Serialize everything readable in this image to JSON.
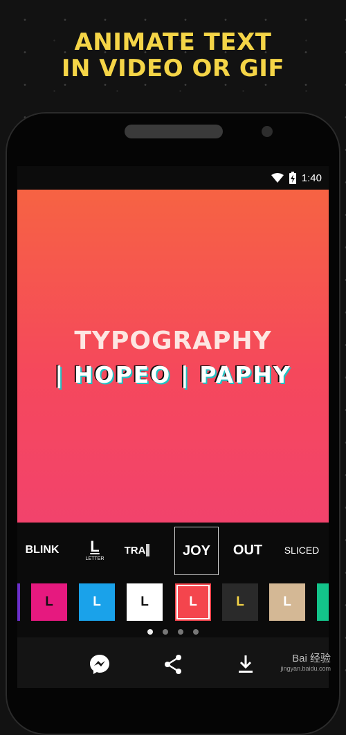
{
  "headline": {
    "line1": "ANIMATE TEXT",
    "line2": "IN VIDEO OR GIF"
  },
  "status_bar": {
    "time": "1:40",
    "icons": [
      "wifi-icon",
      "battery-charging-icon"
    ]
  },
  "preview": {
    "title_text": "TYPOGRAPHY",
    "animated_text": "| HOPEO | PAPHY"
  },
  "effects": [
    {
      "label": "BLINK",
      "selected": false
    },
    {
      "label": "L",
      "sublabel": "LETTER",
      "selected": false
    },
    {
      "label": "TRA",
      "selected": false
    },
    {
      "label": "JOY",
      "selected": true
    },
    {
      "label": "OUT",
      "selected": false
    },
    {
      "label": "SLICED",
      "selected": false
    }
  ],
  "swatches": [
    {
      "label": "",
      "bg": "#6b2fc9",
      "fg": "#ffffff"
    },
    {
      "label": "L",
      "bg": "#e6197f",
      "fg": "#111111"
    },
    {
      "label": "L",
      "bg": "#1aa2ea",
      "fg": "#ffffff"
    },
    {
      "label": "L",
      "bg": "#ffffff",
      "fg": "#111111"
    },
    {
      "label": "L",
      "bg": "#f4454d",
      "fg": "#ffffff",
      "selected": true
    },
    {
      "label": "L",
      "bg": "#2a2a2a",
      "fg": "#f5d547"
    },
    {
      "label": "L",
      "bg": "#d4b895",
      "fg": "#ffffff"
    },
    {
      "label": "",
      "bg": "#13c48a",
      "fg": "#ffffff"
    }
  ],
  "pager": {
    "count": 4,
    "active": 1
  },
  "bottom_actions": [
    "messenger-icon",
    "share-icon",
    "download-icon"
  ],
  "watermark": {
    "brand": "Bai 经验",
    "url": "jingyan.baidu.com"
  },
  "colors": {
    "accent_yellow": "#f5d547",
    "preview_top": "#f66343",
    "preview_bottom": "#f2436c"
  }
}
